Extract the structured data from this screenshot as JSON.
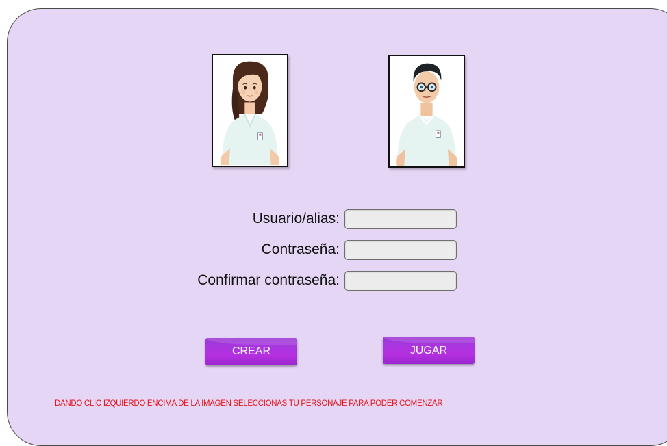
{
  "avatars": [
    {
      "name": "female-character",
      "selected": false
    },
    {
      "name": "male-character",
      "selected": false
    }
  ],
  "form": {
    "user_label": "Usuario/alias:",
    "user_value": "",
    "password_label": "Contraseña:",
    "password_value": "",
    "confirm_label": "Confirmar contraseña:",
    "confirm_value": ""
  },
  "buttons": {
    "create_label": "CREAR",
    "play_label": "JUGAR"
  },
  "instruction": "DANDO CLIC IZQUIERDO ENCIMA DE LA IMAGEN SELECCIONAS TU PERSONAJE PARA PODER COMENZAR",
  "colors": {
    "background": "#e6d6f6",
    "button": "#a936df",
    "instruction_text": "#e4151b"
  }
}
